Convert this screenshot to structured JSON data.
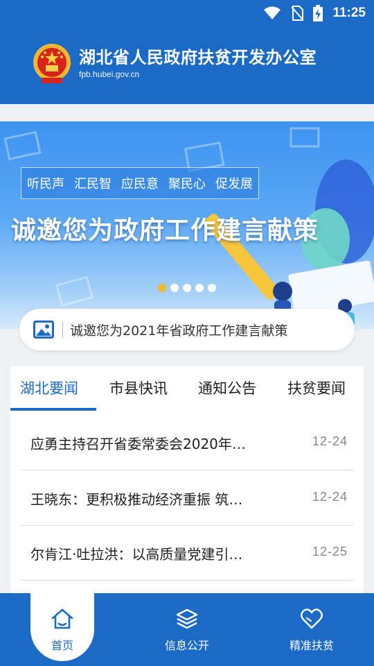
{
  "status": {
    "time": "11:25"
  },
  "header": {
    "title": "湖北省人民政府扶贫开发办公室",
    "subtitle": "fpb.hubei.gov.cn"
  },
  "banner": {
    "tags": [
      "听民声",
      "汇民智",
      "应民意",
      "聚民心",
      "促发展"
    ],
    "headline": "诚邀您为政府工作建言献策",
    "caption": "诚邀您为2021年省政府工作建言献策",
    "dot_count": 5,
    "active_dot": 0
  },
  "news": {
    "tabs": [
      "湖北要闻",
      "市县快讯",
      "通知公告",
      "扶贫要闻"
    ],
    "active_tab": 0,
    "items": [
      {
        "title": "应勇主持召开省委常委会2020年…",
        "date": "12-24"
      },
      {
        "title": "王晓东：更积极推动经济重振 筑…",
        "date": "12-24"
      },
      {
        "title": "尔肯江·吐拉洪：以高质量党建引…",
        "date": "12-25"
      }
    ]
  },
  "nav": {
    "items": [
      {
        "label": "首页",
        "icon": "home-icon"
      },
      {
        "label": "信息公开",
        "icon": "layers-icon"
      },
      {
        "label": "精准扶贫",
        "icon": "heart-icon"
      }
    ],
    "active": 0
  },
  "colors": {
    "primary": "#1b6ac6",
    "accent_dot": "#f5b72b",
    "date_text": "#888888"
  }
}
